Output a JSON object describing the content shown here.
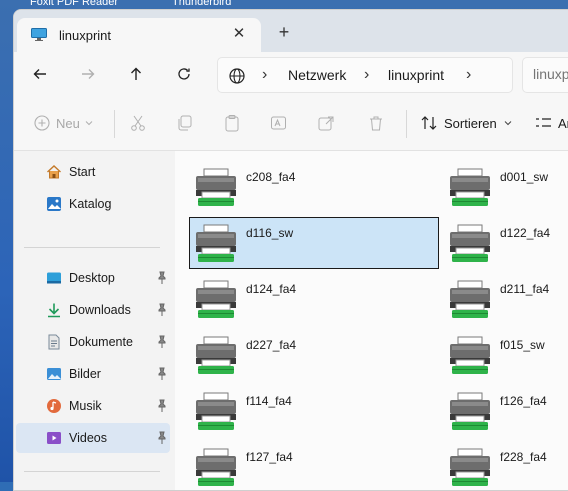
{
  "desktop": {
    "taskbar_labels": [
      "Foxit PDF Reader",
      "Thunderbird"
    ]
  },
  "tab": {
    "title": "linuxprint",
    "icon": "monitor-icon",
    "close_glyph": "✕",
    "new_tab_glyph": "+"
  },
  "nav": {
    "back": "arrow-left-icon",
    "forward": "arrow-right-icon",
    "up": "arrow-up-icon",
    "refresh": "refresh-icon"
  },
  "address": {
    "crumbs": [
      "Netzwerk",
      "linuxprint"
    ],
    "separator": "›"
  },
  "search": {
    "placeholder": "linuxprint"
  },
  "commands": {
    "new_label": "Neu",
    "sort_label": "Sortieren",
    "view_label_partial": "An"
  },
  "sidebar": {
    "items": [
      {
        "label": "Start",
        "icon": "home-icon",
        "pinned": false
      },
      {
        "label": "Katalog",
        "icon": "gallery-icon",
        "pinned": false
      },
      {
        "label": "Desktop",
        "icon": "desktop-icon",
        "pinned": true
      },
      {
        "label": "Downloads",
        "icon": "download-icon",
        "pinned": true
      },
      {
        "label": "Dokumente",
        "icon": "document-icon",
        "pinned": true
      },
      {
        "label": "Bilder",
        "icon": "pictures-icon",
        "pinned": true
      },
      {
        "label": "Musik",
        "icon": "music-icon",
        "pinned": true
      },
      {
        "label": "Videos",
        "icon": "videos-icon",
        "pinned": true
      }
    ],
    "selected": "Videos"
  },
  "printers": [
    {
      "name": "c208_fa4"
    },
    {
      "name": "d001_sw"
    },
    {
      "name": "d116_sw"
    },
    {
      "name": "d122_fa4"
    },
    {
      "name": "d124_fa4"
    },
    {
      "name": "d211_fa4"
    },
    {
      "name": "d227_fa4"
    },
    {
      "name": "f015_sw"
    },
    {
      "name": "f114_fa4"
    },
    {
      "name": "f126_fa4"
    },
    {
      "name": "f127_fa4"
    },
    {
      "name": "f228_fa4"
    }
  ],
  "selected_printer": "d116_sw",
  "colors": {
    "accent": "#cce4f7",
    "printer_green": "#2fb34a",
    "printer_gray": "#6d6d6d"
  }
}
